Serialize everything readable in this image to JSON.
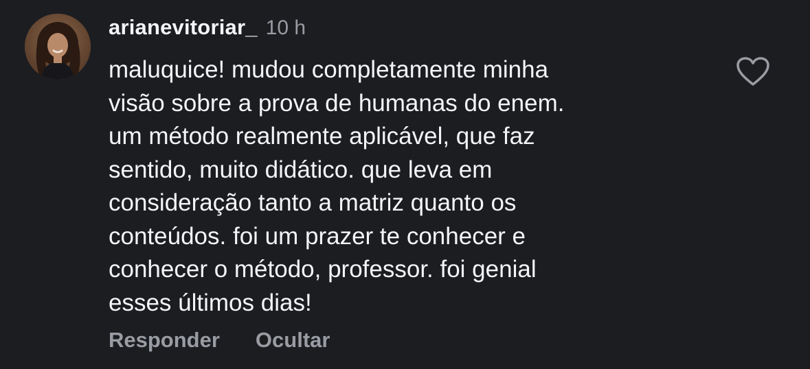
{
  "comment": {
    "username": "arianevitoriar_",
    "time": "10 h",
    "text": "maluquice! mudou completamente minha\nvisão sobre a prova de humanas do enem.\num método realmente aplicável, que faz\nsentido, muito didático. que leva em\nconsideração tanto a matriz quanto os\nconteúdos. foi um prazer te conhecer e\nconhecer o método, professor. foi genial\nesses últimos dias!",
    "like_icon": "heart-outline-icon",
    "actions": {
      "reply_label": "Responder",
      "hide_label": "Ocultar"
    }
  },
  "colors": {
    "background": "#1c1d21",
    "text_primary": "#f4f5f7",
    "text_secondary": "#9a9ca3"
  }
}
